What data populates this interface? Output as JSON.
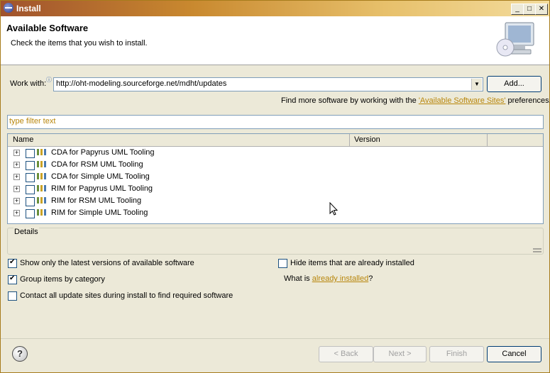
{
  "window": {
    "title": "Install",
    "minimize_glyph": "_",
    "maximize_glyph": "□",
    "close_glyph": "✕"
  },
  "header": {
    "title": "Available Software",
    "subtitle": "Check the items that you wish to install."
  },
  "work_with": {
    "label": "Work with:",
    "value": "http://oht-modeling.sourceforge.net/mdht/updates",
    "add_label": "Add...",
    "hint_prefix": "Find more software by working with the ",
    "hint_link": "'Available Software Sites'",
    "hint_suffix": " preferences."
  },
  "filter": {
    "placeholder": "type filter text"
  },
  "table": {
    "columns": [
      "Name",
      "Version"
    ],
    "rows": [
      {
        "label": "CDA for Papyrus UML Tooling",
        "checked": false
      },
      {
        "label": "CDA for RSM UML Tooling",
        "checked": false
      },
      {
        "label": "CDA for Simple UML Tooling",
        "checked": false
      },
      {
        "label": "RIM for Papyrus UML Tooling",
        "checked": false
      },
      {
        "label": "RIM for RSM UML Tooling",
        "checked": false
      },
      {
        "label": "RIM for Simple UML Tooling",
        "checked": false
      }
    ]
  },
  "details": {
    "label": "Details"
  },
  "options": {
    "show_latest": {
      "label": "Show only the latest versions of available software",
      "checked": true
    },
    "group_by_category": {
      "label": "Group items by category",
      "checked": true
    },
    "contact_all_sites": {
      "label": "Contact all update sites during install to find required software",
      "checked": false
    },
    "hide_installed": {
      "label": "Hide items that are already installed",
      "checked": false
    },
    "what_is_prefix": "What is ",
    "what_is_link": "already installed",
    "what_is_suffix": "?"
  },
  "footer": {
    "help_glyph": "?",
    "back_label": "< Back",
    "next_label": "Next >",
    "finish_label": "Finish",
    "cancel_label": "Cancel"
  },
  "colors": {
    "title_gradient_start": "#a0522d",
    "link": "#b8860b",
    "panel": "#ece9d8",
    "input_border": "#7f9db9"
  }
}
